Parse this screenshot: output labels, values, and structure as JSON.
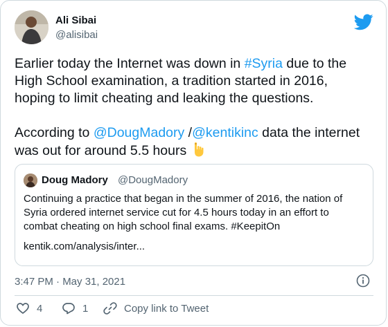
{
  "author": {
    "name": "Ali Sibai",
    "handle": "@alisibai"
  },
  "tweet": {
    "line1_before": "Earlier today the Internet was down in ",
    "hashtag": "#Syria",
    "line1_after": " due to the\nHigh School examination, a tradition started in 2016,\nhoping to limit cheating and leaking the questions.\n\nAccording to ",
    "mention1": "@DougMadory",
    "separator": " /",
    "mention2": "@kentikinc",
    "line2_after": " data the internet\nwas out for around 5.5 hours "
  },
  "quote": {
    "name": "Doug Madory",
    "handle": "@DougMadory",
    "text": "Continuing a practice that began in the summer of 2016, the nation of\nSyria ordered internet service cut for 4.5 hours today in an effort to\ncombat cheating on high school final exams. #KeepitOn",
    "url": "kentik.com/analysis/inter..."
  },
  "timestamp": "3:47 PM · May 31, 2021",
  "actions": {
    "likes": "4",
    "replies": "1",
    "copy_label": "Copy link to Tweet"
  },
  "colors": {
    "link": "#1d9bf0",
    "secondary_text": "#536471",
    "border": "#cfd9de"
  },
  "icons": [
    "twitter-bird-icon",
    "point-down-emoji",
    "info-icon",
    "heart-icon",
    "reply-icon",
    "link-icon"
  ]
}
